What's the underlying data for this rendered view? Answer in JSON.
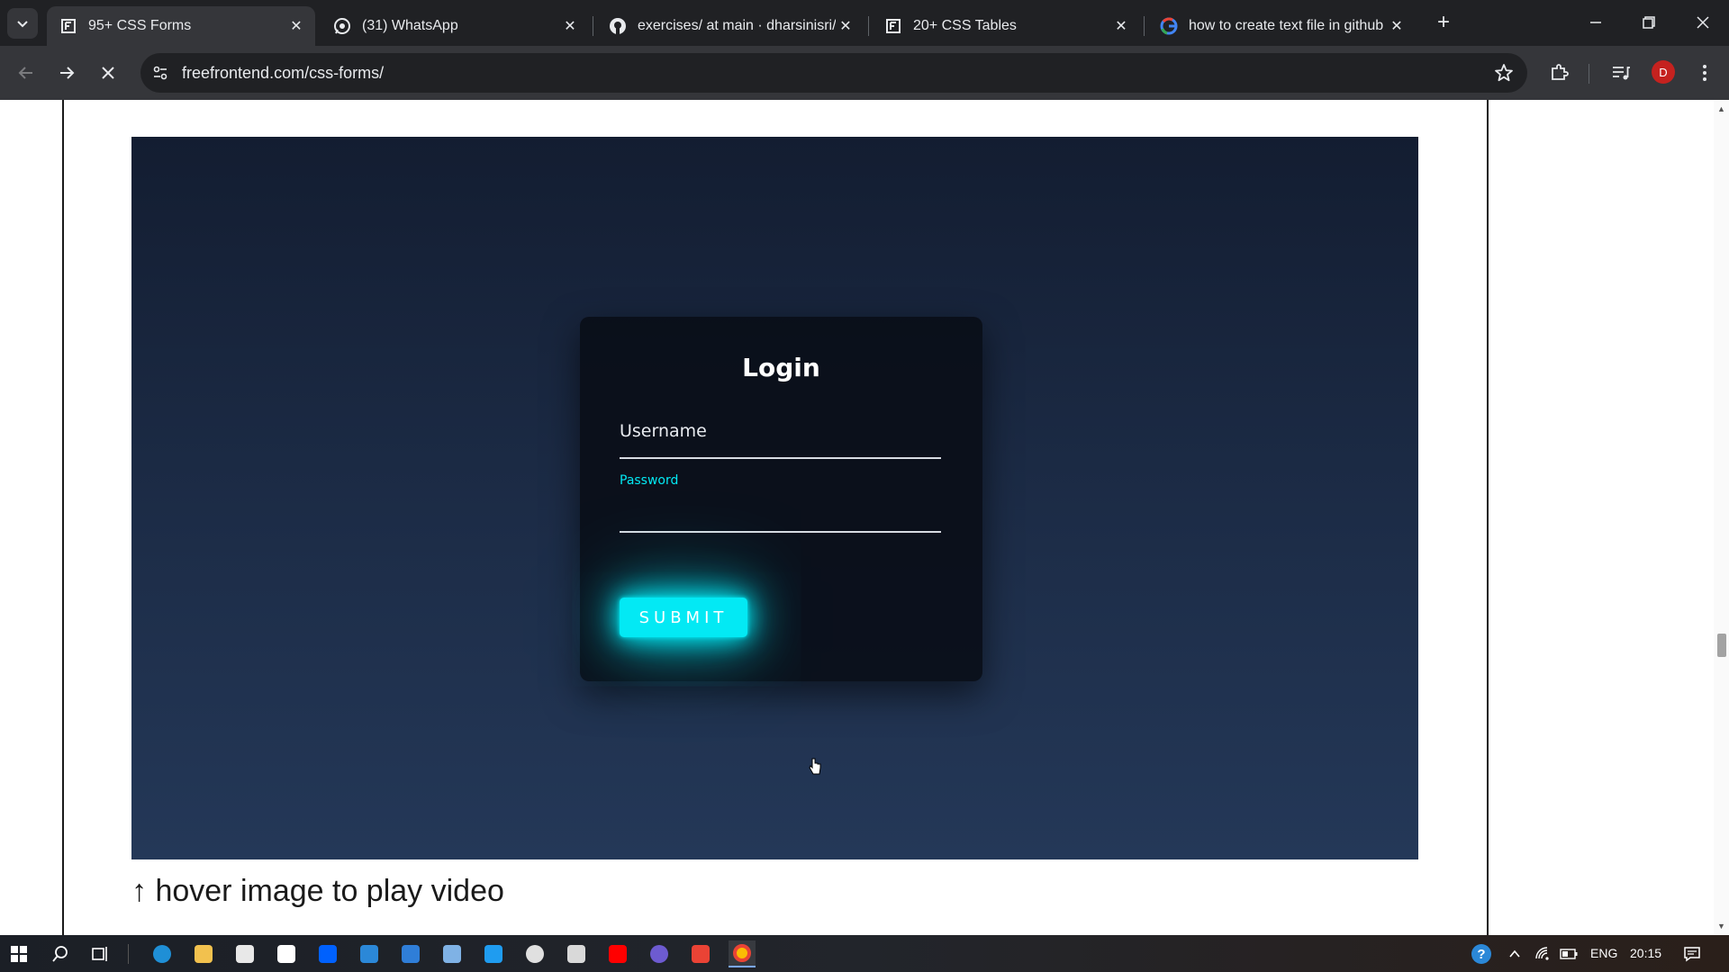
{
  "browser": {
    "tabs": [
      {
        "title": "95+ CSS Forms",
        "icon": "freefrontend-icon",
        "active": true
      },
      {
        "title": "(31) WhatsApp",
        "icon": "whatsapp-icon",
        "active": false
      },
      {
        "title": "exercises/ at main · dharsinisri/e",
        "icon": "github-icon",
        "active": false
      },
      {
        "title": "20+ CSS Tables",
        "icon": "freefrontend-icon",
        "active": false
      },
      {
        "title": "how to create text file in github",
        "icon": "google-icon",
        "active": false
      }
    ],
    "address_bar": {
      "url": "freefrontend.com/css-forms/"
    },
    "profile_initial": "D"
  },
  "demo": {
    "form": {
      "title": "Login",
      "username_placeholder": "Username",
      "password_label": "Password",
      "submit_label": "SUBMIT"
    },
    "caption": "↑ hover image to play video"
  },
  "colors": {
    "accent": "#03e9f4",
    "demo_bg_top": "#131d31",
    "demo_bg_bottom": "#243858",
    "card_bg": "#0a0e18"
  },
  "taskbar": {
    "language": "ENG",
    "time": "20:15"
  }
}
